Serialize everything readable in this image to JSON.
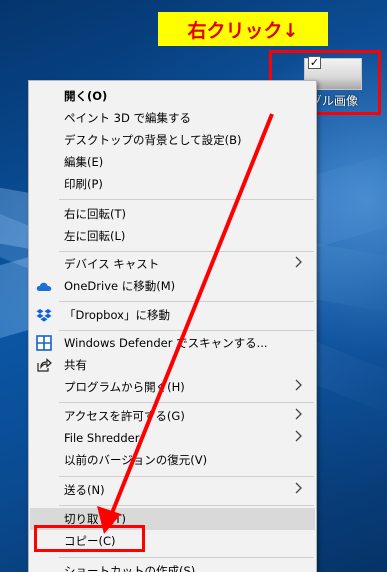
{
  "banner": {
    "text": "右クリック↓"
  },
  "desktop_icon": {
    "label": "ゾル画像",
    "check": "✓"
  },
  "menu": {
    "items": [
      {
        "label": "開く(O)"
      },
      {
        "label": "ペイント 3D で編集する"
      },
      {
        "label": "デスクトップの背景として設定(B)"
      },
      {
        "label": "編集(E)"
      },
      {
        "label": "印刷(P)"
      },
      {
        "label": "右に回転(T)"
      },
      {
        "label": "左に回転(L)"
      },
      {
        "label": "デバイス キャスト"
      },
      {
        "label": "OneDrive に移動(M)"
      },
      {
        "label": "「Dropbox」に移動"
      },
      {
        "label": "Windows Defender でスキャンする..."
      },
      {
        "label": "共有"
      },
      {
        "label": "プログラムから開く(H)"
      },
      {
        "label": "アクセスを許可する(G)"
      },
      {
        "label": "File Shredder"
      },
      {
        "label": "以前のバージョンの復元(V)"
      },
      {
        "label": "送る(N)"
      },
      {
        "label": "切り取り(T)"
      },
      {
        "label": "コピー(C)"
      },
      {
        "label": "ショートカットの作成(S)"
      }
    ]
  },
  "colors": {
    "highlight_red": "#ff0000",
    "banner_yellow": "#ffff00",
    "menu_bg": "#f2f2f2",
    "hover_bg": "#d9d9d9"
  },
  "icons": {
    "onedrive": "cloud-icon",
    "dropbox": "dropbox-icon",
    "defender": "shield-icon",
    "share": "share-icon",
    "submenu": "chevron-right-icon"
  }
}
